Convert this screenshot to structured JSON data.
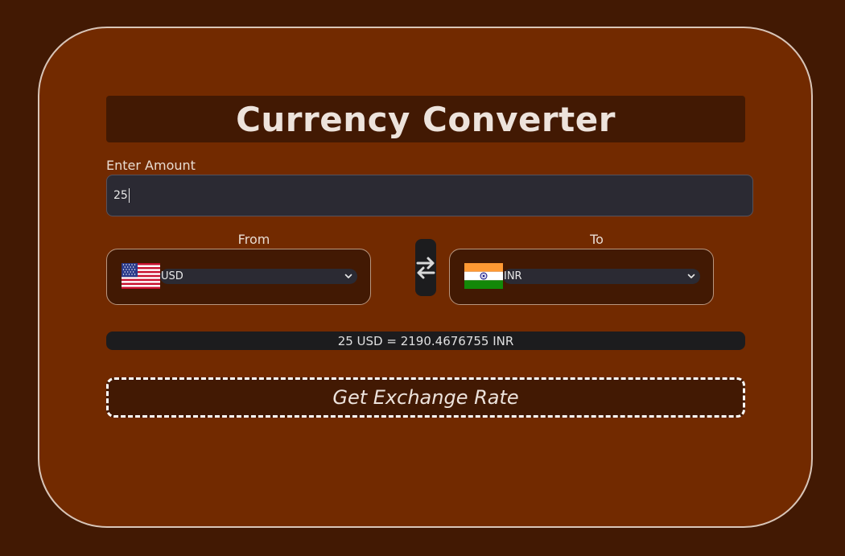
{
  "app": {
    "title": "Currency Converter"
  },
  "amount": {
    "label": "Enter Amount",
    "value": "25"
  },
  "from": {
    "label": "From",
    "currency": "USD",
    "flag_icon": "us-flag-icon"
  },
  "to": {
    "label": "To",
    "currency": "INR",
    "flag_icon": "india-flag-icon"
  },
  "swap": {
    "icon": "swap-arrows-icon"
  },
  "result": {
    "text": "25 USD = 2190.4676755 INR"
  },
  "button": {
    "label": "Get Exchange Rate"
  },
  "colors": {
    "page_bg": "#421903",
    "card_bg": "#722A00",
    "panel_bg": "#421903",
    "input_bg": "#2b2a33",
    "text": "#ede3dc"
  }
}
